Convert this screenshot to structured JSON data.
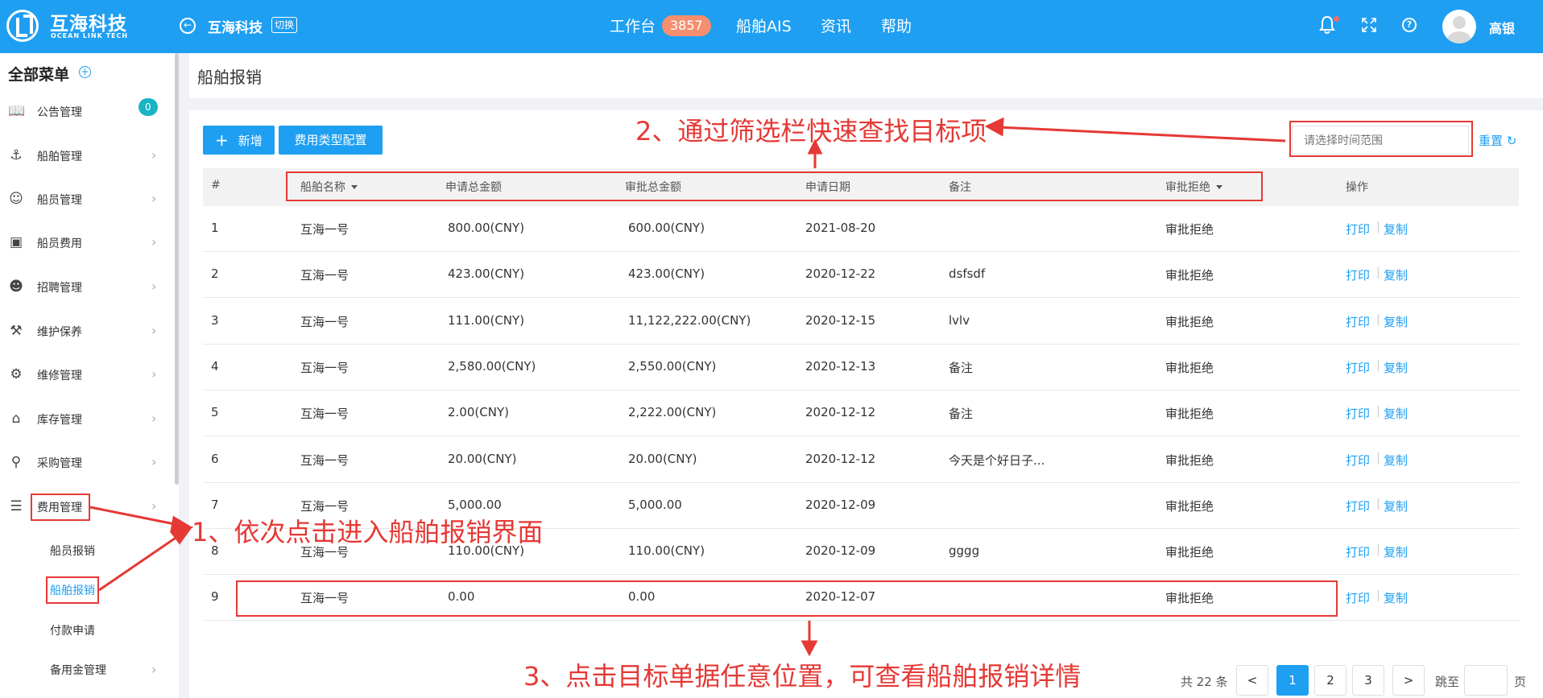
{
  "header": {
    "logo_cn": "互海科技",
    "logo_en": "OCEAN LINK TECH",
    "org_name": "互海科技",
    "switch_label": "切换",
    "nav": [
      {
        "label": "工作台",
        "badge": "3857"
      },
      {
        "label": "船舶AIS"
      },
      {
        "label": "资讯"
      },
      {
        "label": "帮助"
      }
    ],
    "user_name": "高银"
  },
  "sidebar": {
    "title": "全部菜单",
    "items": [
      {
        "label": "公告管理",
        "icon": "book-icon",
        "badge": "0"
      },
      {
        "label": "船舶管理",
        "icon": "anchor-icon"
      },
      {
        "label": "船员管理",
        "icon": "user-icon"
      },
      {
        "label": "船员费用",
        "icon": "wallet-icon"
      },
      {
        "label": "招聘管理",
        "icon": "recruit-icon"
      },
      {
        "label": "维护保养",
        "icon": "maintenance-icon"
      },
      {
        "label": "维修管理",
        "icon": "wrench-icon"
      },
      {
        "label": "库存管理",
        "icon": "home-icon"
      },
      {
        "label": "采购管理",
        "icon": "cart-icon"
      },
      {
        "label": "费用管理",
        "icon": "database-icon"
      }
    ],
    "subitems": [
      "船员报销",
      "船舶报销",
      "付款申请",
      "备用金管理"
    ]
  },
  "page": {
    "title": "船舶报销",
    "add_button": "新增",
    "fee_config_button": "费用类型配置",
    "date_placeholder": "请选择时间范围",
    "reset_label": "重置"
  },
  "table": {
    "columns": [
      "#",
      "船舶名称",
      "申请总金额",
      "审批总金额",
      "申请日期",
      "备注",
      "审批拒绝",
      "操作"
    ],
    "rows": [
      {
        "no": "1",
        "ship": "互海一号",
        "apply": "800.00(CNY)",
        "approve": "600.00(CNY)",
        "date": "2021-08-20",
        "note": "",
        "status": "审批拒绝"
      },
      {
        "no": "2",
        "ship": "互海一号",
        "apply": "423.00(CNY)",
        "approve": "423.00(CNY)",
        "date": "2020-12-22",
        "note": "dsfsdf",
        "status": "审批拒绝"
      },
      {
        "no": "3",
        "ship": "互海一号",
        "apply": "111.00(CNY)",
        "approve": "11,122,222.00(CNY)",
        "date": "2020-12-15",
        "note": "lvlv",
        "status": "审批拒绝"
      },
      {
        "no": "4",
        "ship": "互海一号",
        "apply": "2,580.00(CNY)",
        "approve": "2,550.00(CNY)",
        "date": "2020-12-13",
        "note": "备注",
        "status": "审批拒绝"
      },
      {
        "no": "5",
        "ship": "互海一号",
        "apply": "2.00(CNY)",
        "approve": "2,222.00(CNY)",
        "date": "2020-12-12",
        "note": "备注",
        "status": "审批拒绝"
      },
      {
        "no": "6",
        "ship": "互海一号",
        "apply": "20.00(CNY)",
        "approve": "20.00(CNY)",
        "date": "2020-12-12",
        "note": "今天是个好日子...",
        "status": "审批拒绝"
      },
      {
        "no": "7",
        "ship": "互海一号",
        "apply": "5,000.00",
        "approve": "5,000.00",
        "date": "2020-12-09",
        "note": "",
        "status": "审批拒绝"
      },
      {
        "no": "8",
        "ship": "互海一号",
        "apply": "110.00(CNY)",
        "approve": "110.00(CNY)",
        "date": "2020-12-09",
        "note": "gggg",
        "status": "审批拒绝"
      },
      {
        "no": "9",
        "ship": "互海一号",
        "apply": "0.00",
        "approve": "0.00",
        "date": "2020-12-07",
        "note": "",
        "status": "审批拒绝"
      }
    ],
    "action_print": "打印",
    "action_copy": "复制"
  },
  "pagination": {
    "total_label": "共 22 条",
    "prev": "<",
    "pages": [
      "1",
      "2",
      "3"
    ],
    "next": ">",
    "jump_label": "跳至",
    "page_label": "页"
  },
  "annotations": {
    "step1": "1、依次点击进入船舶报销界面",
    "step2": "2、通过筛选栏快速查找目标项",
    "step3": "3、点击目标单据任意位置，可查看船舶报销详情"
  },
  "colors": {
    "primary": "#1e9ff2",
    "annotation": "#e53935",
    "badge": "#f58f6f",
    "teal_badge": "#17b4c4"
  }
}
